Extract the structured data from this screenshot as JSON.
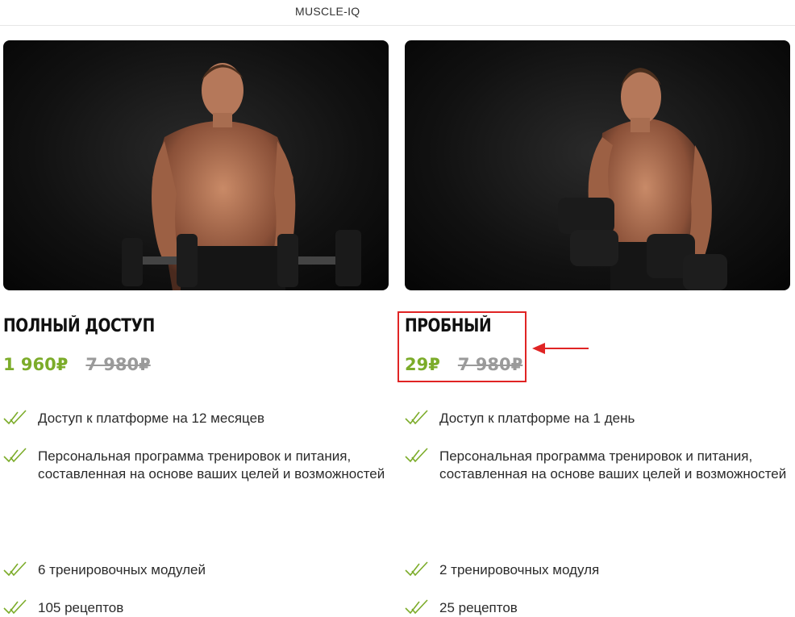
{
  "header": {
    "brand": "MUSCLE-IQ"
  },
  "plans": [
    {
      "title": "ПОЛНЫЙ ДОСТУП",
      "price": "1 960₽",
      "old_price": "7 980₽",
      "features": [
        "Доступ к платформе на 12 месяцев",
        "Персональная программа тренировок и питания, составленная на основе ваших целей и возможностей",
        "6 тренировочных модулей",
        "105 рецептов"
      ]
    },
    {
      "title": "ПРОБНЫЙ",
      "price": "29₽",
      "old_price": "7 980₽",
      "features": [
        "Доступ к платформе на 1 день",
        "Персональная программа тренировок и питания, составленная на основе ваших целей и возможностей",
        "2 тренировочных модуля",
        "25 рецептов"
      ]
    }
  ],
  "colors": {
    "accent": "#7cac2a",
    "old_price": "#9a9a9a",
    "annotation": "#e02424"
  },
  "icons": {
    "feature": "double-check-icon",
    "annotation": "left-arrow-icon"
  }
}
